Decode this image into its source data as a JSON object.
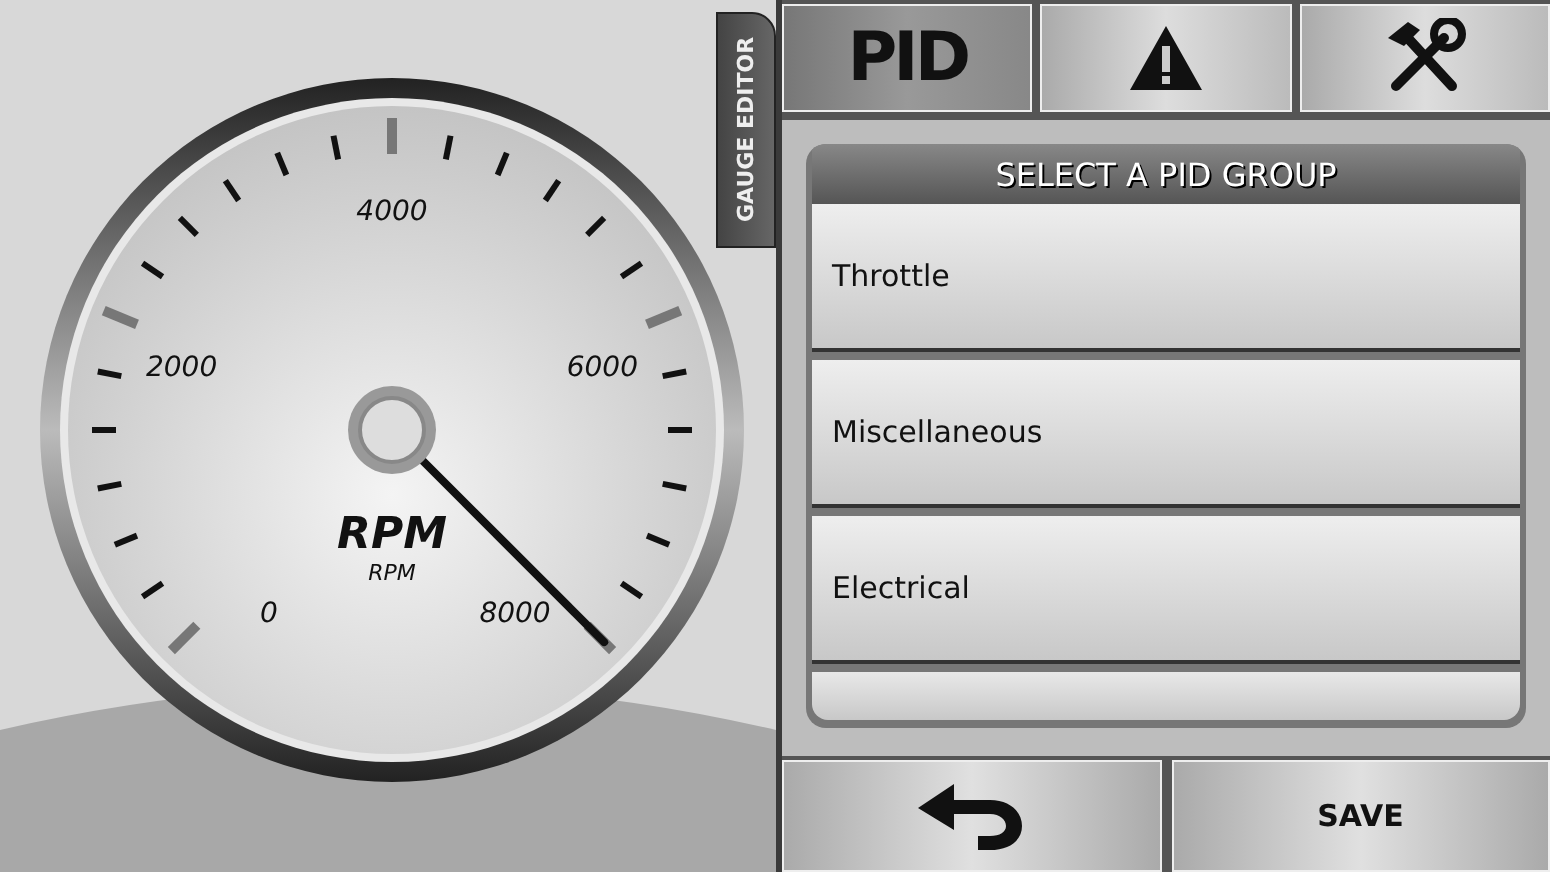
{
  "side_tab": {
    "label": "GAUGE EDITOR"
  },
  "gauge": {
    "title": "RPM",
    "unit": "RPM",
    "scale_labels": [
      "0",
      "2000",
      "4000",
      "6000",
      "8000"
    ]
  },
  "tabs": [
    {
      "kind": "text",
      "label": "PID",
      "selected": true
    },
    {
      "kind": "warning",
      "selected": false
    },
    {
      "kind": "tools",
      "selected": false
    }
  ],
  "panel": {
    "title": "SELECT A PID GROUP",
    "items": [
      "Throttle",
      "Miscellaneous",
      "Electrical"
    ]
  },
  "buttons": [
    {
      "kind": "back"
    },
    {
      "kind": "text",
      "label": "SAVE"
    }
  ]
}
